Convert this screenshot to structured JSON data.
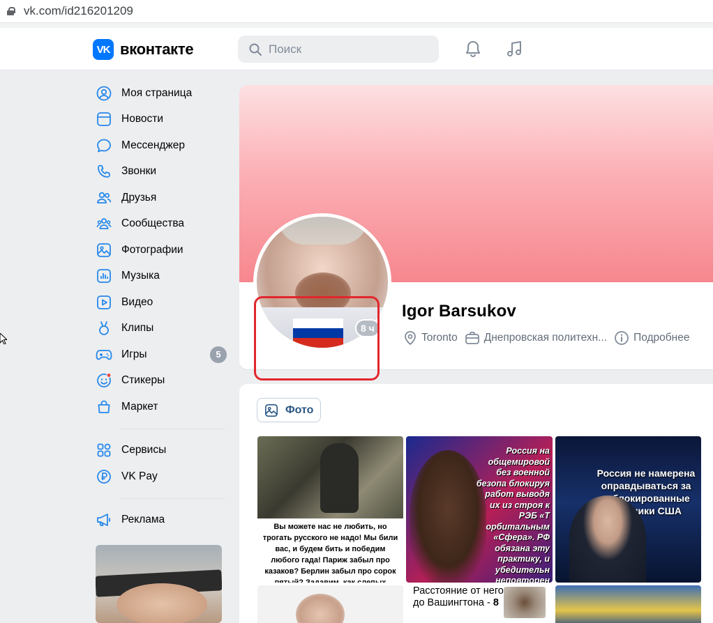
{
  "browser": {
    "url": "vk.com/id216201209"
  },
  "header": {
    "logo_mark": "VK",
    "logo_text": "вконтакте",
    "search_placeholder": "Поиск",
    "icons": [
      "bell-icon",
      "music-note-icon"
    ]
  },
  "nav": {
    "items": [
      {
        "label": "Моя страница",
        "icon": "user-circle-icon"
      },
      {
        "label": "Новости",
        "icon": "news-icon"
      },
      {
        "label": "Мессенджер",
        "icon": "chat-bubble-icon"
      },
      {
        "label": "Звонки",
        "icon": "phone-icon"
      },
      {
        "label": "Друзья",
        "icon": "friends-icon"
      },
      {
        "label": "Сообщества",
        "icon": "communities-icon"
      },
      {
        "label": "Фотографии",
        "icon": "photo-icon"
      },
      {
        "label": "Музыка",
        "icon": "music-icon"
      },
      {
        "label": "Видео",
        "icon": "video-icon"
      },
      {
        "label": "Клипы",
        "icon": "clips-icon"
      },
      {
        "label": "Игры",
        "icon": "gamepad-icon",
        "badge": "5"
      },
      {
        "label": "Стикеры",
        "icon": "sticker-icon"
      },
      {
        "label": "Маркет",
        "icon": "bag-icon"
      }
    ],
    "extra": [
      {
        "label": "Сервисы",
        "icon": "grid-icon"
      },
      {
        "label": "VK Pay",
        "icon": "ruble-icon"
      }
    ],
    "ads": {
      "label": "Реклама",
      "icon": "megaphone-icon"
    }
  },
  "profile": {
    "name": "Igor Barsukov",
    "online_time": "8 ч",
    "location": "Toronto",
    "work": "Днепровская политехн...",
    "more": "Подробнее"
  },
  "photos": {
    "tab_label": "Фото",
    "items": [
      {
        "caption": "Вы можете нас не любить, но трогать русского не надо! Мы били вас, и будем бить и победим любого гада! Париж забыл про казаков? Берлин забыл про сорок пятый? Задавим, как слепых щенков!"
      },
      {
        "caption": "Россия на общемировой без военной безопа блокируя работ выводя их из строя к РЭБ «Т орбитальным «Сфера». РФ обязана эту практику, и убедительн неповторен"
      },
      {
        "caption": "Россия не намерена оправдываться за заблокированные спутники США"
      },
      {
        "caption": ""
      },
      {
        "caption": "Расстояние от него до Вашингтона -",
        "number": "8"
      },
      {
        "caption": ""
      }
    ]
  },
  "colors": {
    "accent": "#0077ff",
    "link": "#2a5885",
    "highlight_box": "#e2262c",
    "flag_white": "#ffffff",
    "flag_blue": "#0039a6",
    "flag_red": "#d52b1e"
  }
}
